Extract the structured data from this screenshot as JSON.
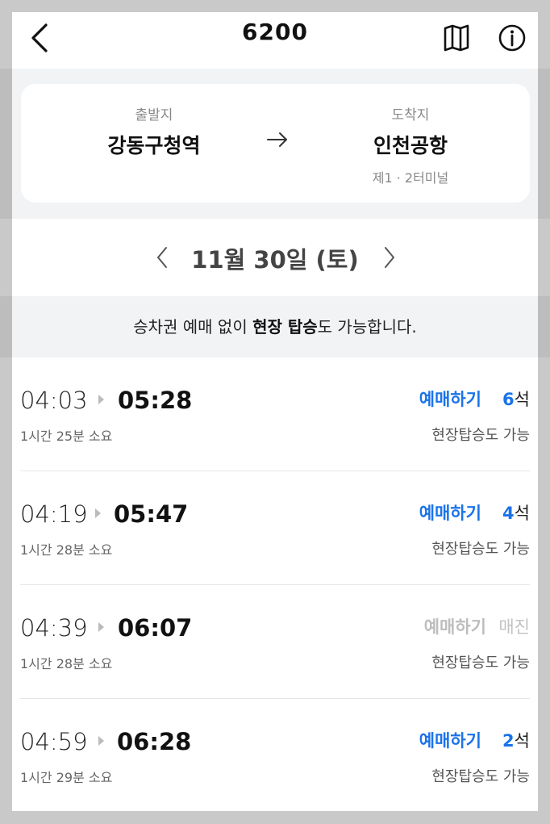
{
  "header": {
    "title": "6200"
  },
  "route": {
    "departure_caption": "출발지",
    "departure": "강동구청역",
    "arrival_caption": "도착지",
    "arrival": "인천공항",
    "arrival_sub": "제1 · 2터미널"
  },
  "date": {
    "label": "11월 30일 (토)"
  },
  "notice": {
    "before": "승차권 예매 없이 ",
    "bold": "현장 탑승",
    "after": "도 가능합니다."
  },
  "trips": [
    {
      "depart": "04:03",
      "arrive": "05:28",
      "duration": "1시간 25분 소요",
      "reserve": "예매하기",
      "seats_num": "6",
      "seats_unit": "석",
      "onsite": "현장탑승도 가능",
      "sold_out": false
    },
    {
      "depart": "04:19",
      "arrive": "05:47",
      "duration": "1시간 28분 소요",
      "reserve": "예매하기",
      "seats_num": "4",
      "seats_unit": "석",
      "onsite": "현장탑승도 가능",
      "sold_out": false
    },
    {
      "depart": "04:39",
      "arrive": "06:07",
      "duration": "1시간 28분 소요",
      "reserve": "예매하기",
      "seats_num": "",
      "seats_unit": "매진",
      "onsite": "현장탑승도 가능",
      "sold_out": true
    },
    {
      "depart": "04:59",
      "arrive": "06:28",
      "duration": "1시간 29분 소요",
      "reserve": "예매하기",
      "seats_num": "2",
      "seats_unit": "석",
      "onsite": "현장탑승도 가능",
      "sold_out": false
    }
  ],
  "colors": {
    "accent": "#1a73e8",
    "disabled": "#bdbdbd",
    "card_bg": "#f2f3f5"
  },
  "icons": [
    "back-icon",
    "map-icon",
    "info-icon",
    "arrow-right-icon",
    "chevron-left-icon",
    "chevron-right-icon",
    "play-triangle-icon"
  ]
}
